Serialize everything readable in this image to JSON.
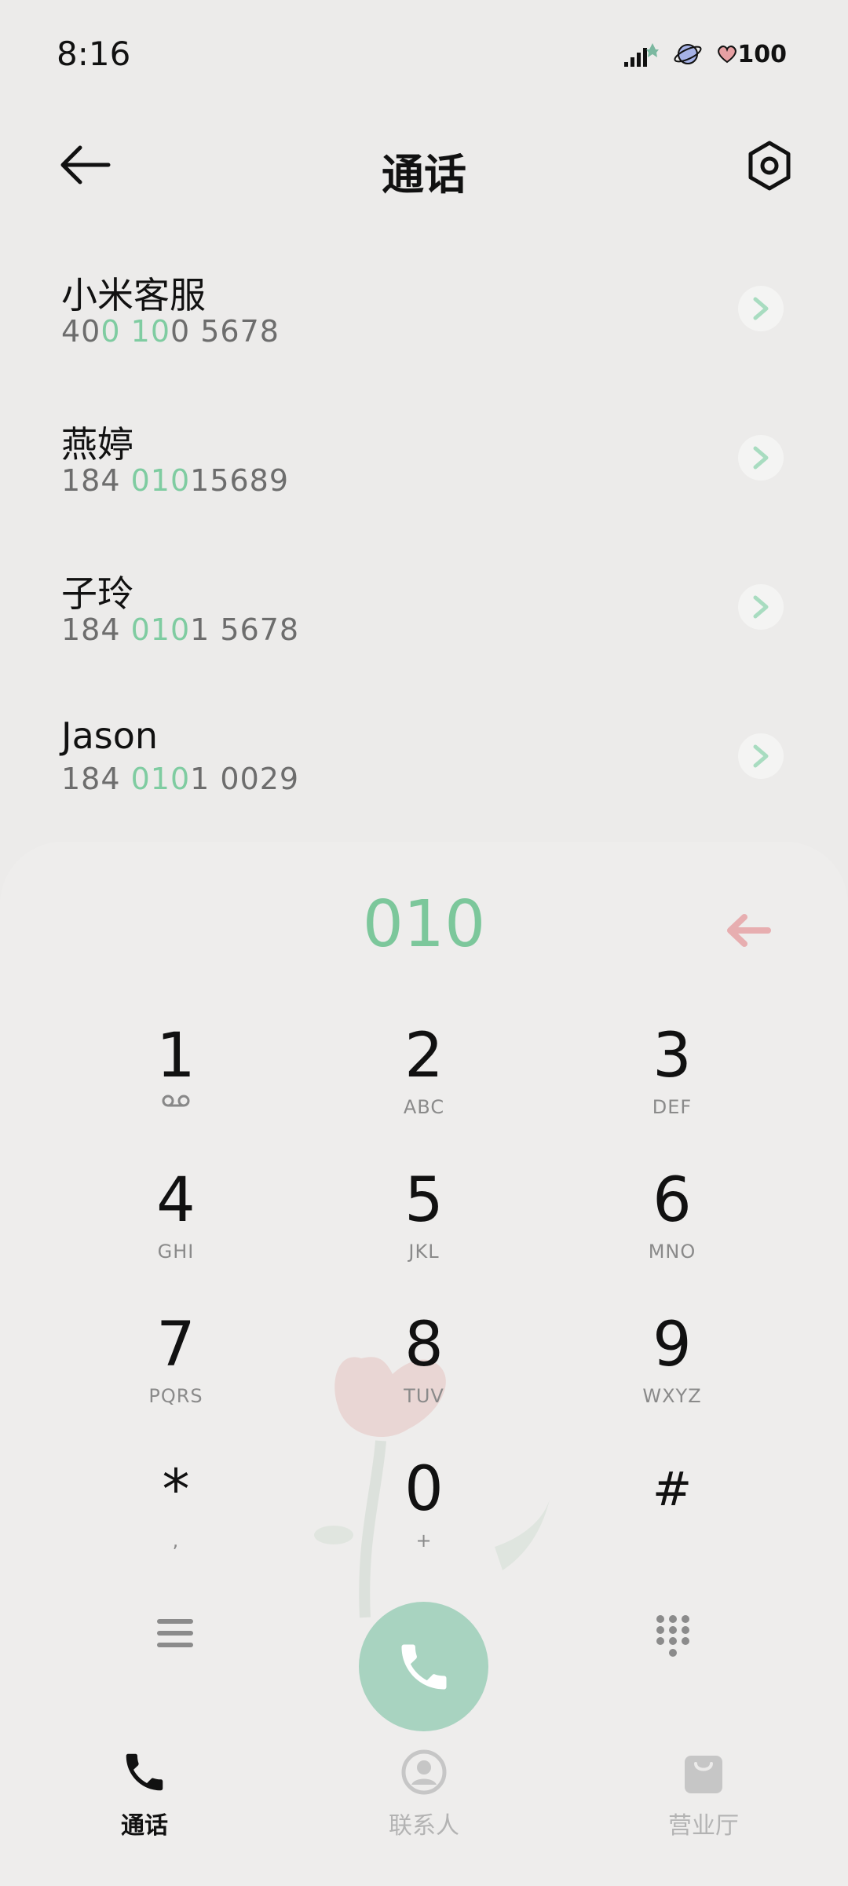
{
  "status": {
    "time": "8:16",
    "battery": "100"
  },
  "header": {
    "title": "通话"
  },
  "contacts": [
    {
      "name": "小米客服",
      "number_parts": [
        "40",
        "0",
        " ",
        "10",
        "0 5678"
      ]
    },
    {
      "name": "燕婷",
      "number_parts": [
        "184 ",
        "010",
        "15689"
      ]
    },
    {
      "name": "子玲",
      "number_parts": [
        "184 ",
        "010",
        "1 5678"
      ]
    },
    {
      "name": "Jason",
      "number_parts": [
        "184 ",
        "010",
        "1 0029"
      ]
    }
  ],
  "dialpad": {
    "input": "010",
    "keys": [
      {
        "main": "1",
        "sub": "voicemail-icon"
      },
      {
        "main": "2",
        "sub": "ABC"
      },
      {
        "main": "3",
        "sub": "DEF"
      },
      {
        "main": "4",
        "sub": "GHI"
      },
      {
        "main": "5",
        "sub": "JKL"
      },
      {
        "main": "6",
        "sub": "MNO"
      },
      {
        "main": "7",
        "sub": "PQRS"
      },
      {
        "main": "8",
        "sub": "TUV"
      },
      {
        "main": "9",
        "sub": "WXYZ"
      },
      {
        "main": "*",
        "sub": ","
      },
      {
        "main": "0",
        "sub": "+"
      },
      {
        "main": "#",
        "sub": ""
      }
    ]
  },
  "nav": {
    "calls": "通话",
    "contacts": "联系人",
    "store": "营业厅"
  },
  "colors": {
    "accent": "#7cc79b",
    "call_button": "#a8d3c0",
    "backspace": "#e7aeb0"
  }
}
